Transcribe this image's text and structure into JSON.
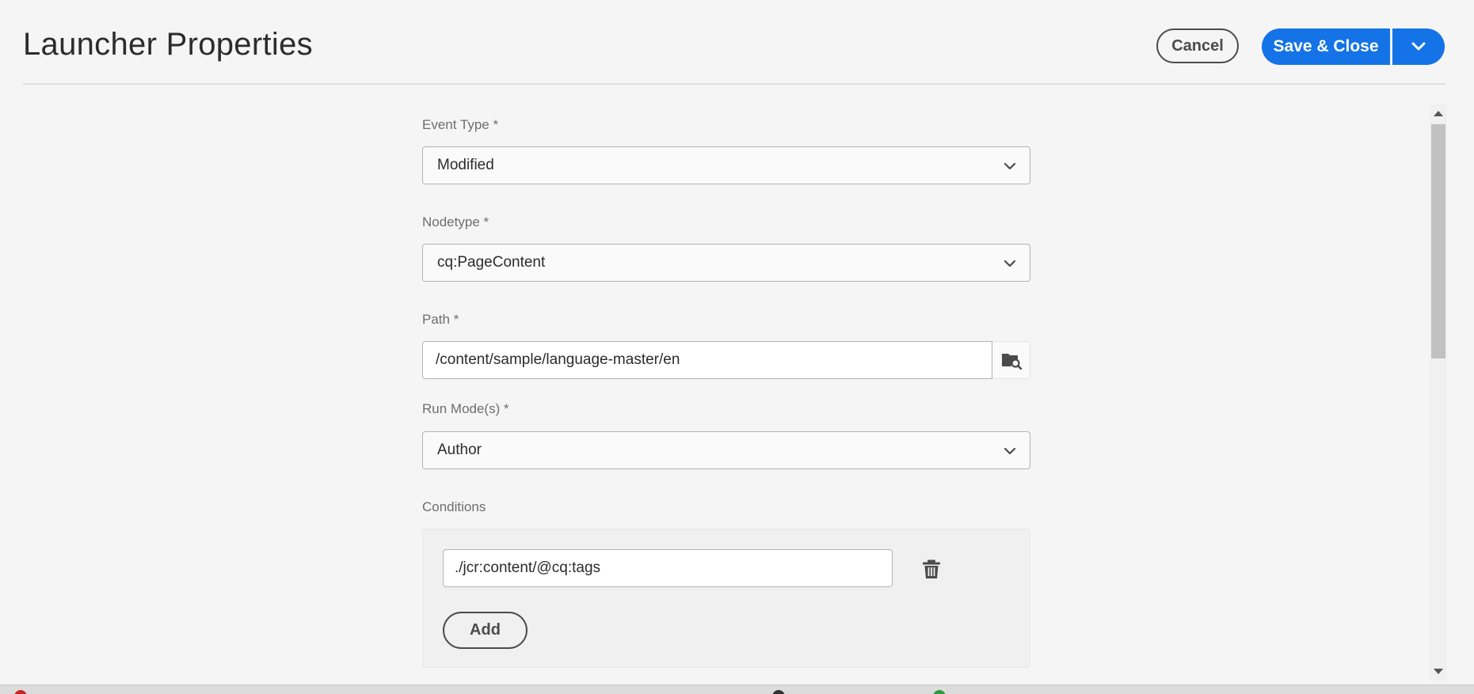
{
  "header": {
    "title": "Launcher Properties",
    "cancel_label": "Cancel",
    "save_label": "Save & Close"
  },
  "form": {
    "event_type": {
      "label": "Event Type *",
      "value": "Modified"
    },
    "nodetype": {
      "label": "Nodetype *",
      "value": "cq:PageContent"
    },
    "path": {
      "label": "Path *",
      "value": "/content/sample/language-master/en"
    },
    "run_modes": {
      "label": "Run Mode(s) *",
      "value": "Author"
    },
    "conditions": {
      "label": "Conditions",
      "items": [
        {
          "value": "./jcr:content/@cq:tags"
        }
      ],
      "add_label": "Add"
    }
  },
  "colors": {
    "accent": "#1473e6",
    "background": "#f5f5f5",
    "button_outline": "#4b4b4b"
  },
  "icons": {
    "save_more": "chevron-down-icon",
    "select_chevron": "chevron-down-icon",
    "browse": "folder-search-icon",
    "delete": "trash-icon"
  }
}
